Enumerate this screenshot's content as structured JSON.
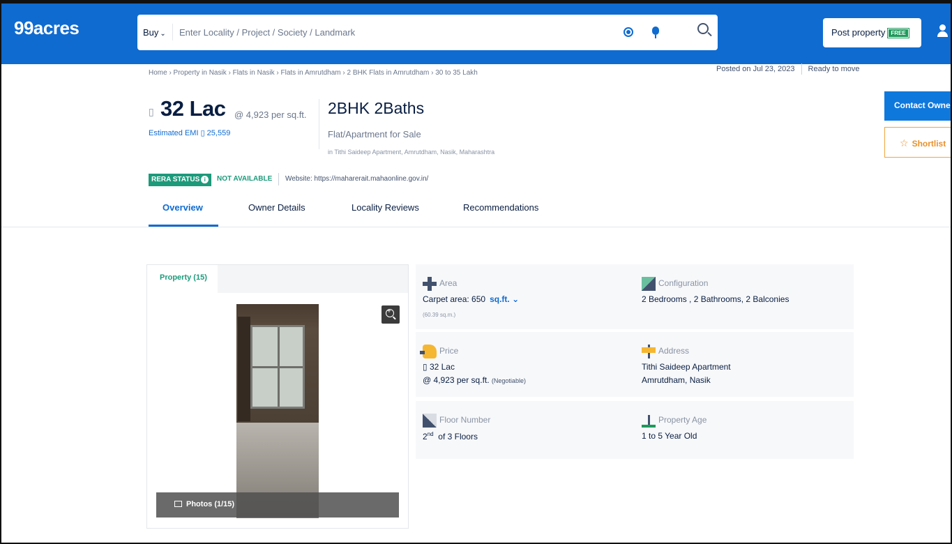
{
  "header": {
    "logo": "99acres",
    "buy_label": "Buy",
    "search_placeholder": "Enter Locality / Project / Society / Landmark",
    "post_property_label": "Post property",
    "free_badge": "FREE"
  },
  "breadcrumb": "Home › Property in Nasik › Flats in Nasik › Flats in Amrutdham › 2 BHK Flats in Amrutdham › 30 to 35 Lakh",
  "meta": {
    "posted": "Posted on Jul 23, 2023",
    "status": "Ready to move"
  },
  "listing": {
    "rupee_glyph": "▯",
    "price": "32 Lac",
    "rate": "@ 4,923 per sq.ft.",
    "emi": "Estimated EMI ▯ 25,559",
    "title": "2BHK 2Baths",
    "subtitle": "Flat/Apartment for Sale",
    "location": "in Tithi Saideep Apartment, Amrutdham, Nasik, Maharashtra"
  },
  "actions": {
    "contact_label": "Contact Owner",
    "shortlist_label": "Shortlist"
  },
  "rera": {
    "badge": "RERA STATUS",
    "status": "NOT AVAILABLE",
    "website": "Website: https://maharerait.mahaonline.gov.in/"
  },
  "tabs": [
    {
      "label": "Overview"
    },
    {
      "label": "Owner Details"
    },
    {
      "label": "Locality Reviews"
    },
    {
      "label": "Recommendations"
    }
  ],
  "gallery": {
    "tab_label": "Property (15)",
    "photos_label": "Photos (1/15)"
  },
  "details": {
    "area": {
      "label": "Area",
      "value": "Carpet area: 650",
      "unit": "sq.ft.",
      "sub": "(60.39 sq.m.)"
    },
    "configuration": {
      "label": "Configuration",
      "value": "2 Bedrooms , 2 Bathrooms, 2 Balconies"
    },
    "price": {
      "label": "Price",
      "value": "▯ 32 Lac",
      "rate": "@ 4,923 per sq.ft.",
      "negotiable": "(Negotiable)"
    },
    "address": {
      "label": "Address",
      "line1": "Tithi Saideep Apartment",
      "line2": "Amrutdham, Nasik"
    },
    "floor": {
      "label": "Floor Number",
      "ordinal": "2",
      "suffix": "nd",
      "rest": "of 3 Floors"
    },
    "age": {
      "label": "Property Age",
      "value": "1 to 5 Year Old"
    }
  },
  "colors": {
    "brand_blue": "#0f6bd0",
    "rera_green": "#1d9a7a",
    "shortlist_orange": "#e8912b"
  }
}
